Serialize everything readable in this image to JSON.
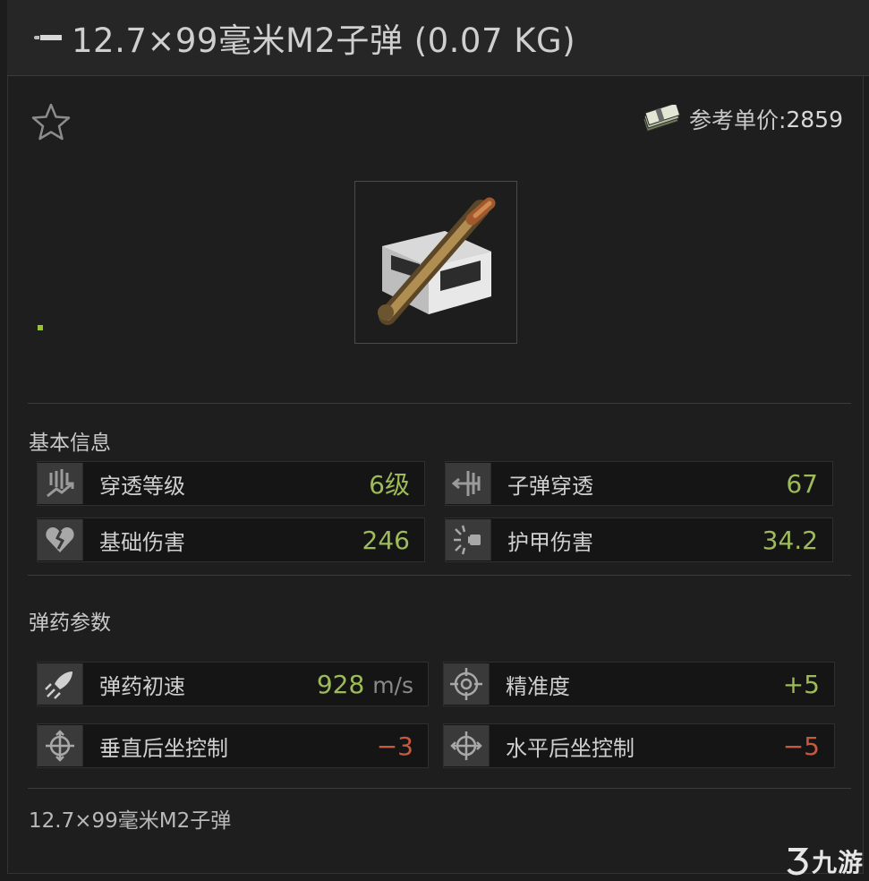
{
  "title": "12.7×99毫米M2子弹 (0.07 KG)",
  "price": {
    "label": "参考单价:",
    "value": "2859"
  },
  "basic_section": {
    "title": "基本信息",
    "stats": [
      {
        "label": "穿透等级",
        "value": "6级",
        "color": "green",
        "icon": "penetration-level-icon"
      },
      {
        "label": "子弹穿透",
        "value": "67",
        "color": "green",
        "icon": "bullet-penetration-icon"
      },
      {
        "label": "基础伤害",
        "value": "246",
        "color": "green",
        "icon": "broken-heart-icon"
      },
      {
        "label": "护甲伤害",
        "value": "34.2",
        "color": "green",
        "icon": "armor-damage-icon"
      }
    ]
  },
  "ammo_section": {
    "title": "弹药参数",
    "stats": [
      {
        "label": "弹药初速",
        "value": "928",
        "unit": "m/s",
        "color": "green",
        "icon": "velocity-icon"
      },
      {
        "label": "精准度",
        "value": "+5",
        "color": "green",
        "icon": "crosshair-icon"
      },
      {
        "label": "垂直后坐控制",
        "value": "−3",
        "color": "red",
        "icon": "vertical-recoil-icon"
      },
      {
        "label": "水平后坐控制",
        "value": "−5",
        "color": "red",
        "icon": "horizontal-recoil-icon"
      }
    ]
  },
  "footer_name": "12.7×99毫米M2子弹",
  "watermark": "九游",
  "colors": {
    "positive": "#9dbb5a",
    "negative": "#c8593f",
    "accent_dot": "#9ac42f"
  }
}
